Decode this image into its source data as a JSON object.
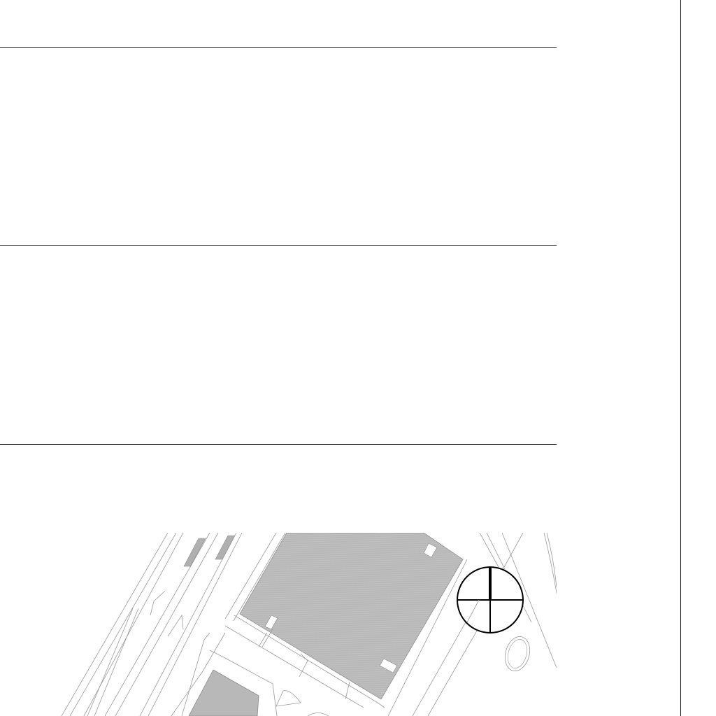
{
  "sheet": {
    "background": "#ffffff",
    "line_color": "#1a1a1a"
  },
  "site_plan": {
    "building_fill": "#b8b8b8",
    "line_color": "#9a9a9a",
    "hatch_color": "#d4d4d4"
  },
  "north_arrow": {
    "icon": "north-arrow-icon",
    "stroke": "#000000"
  }
}
